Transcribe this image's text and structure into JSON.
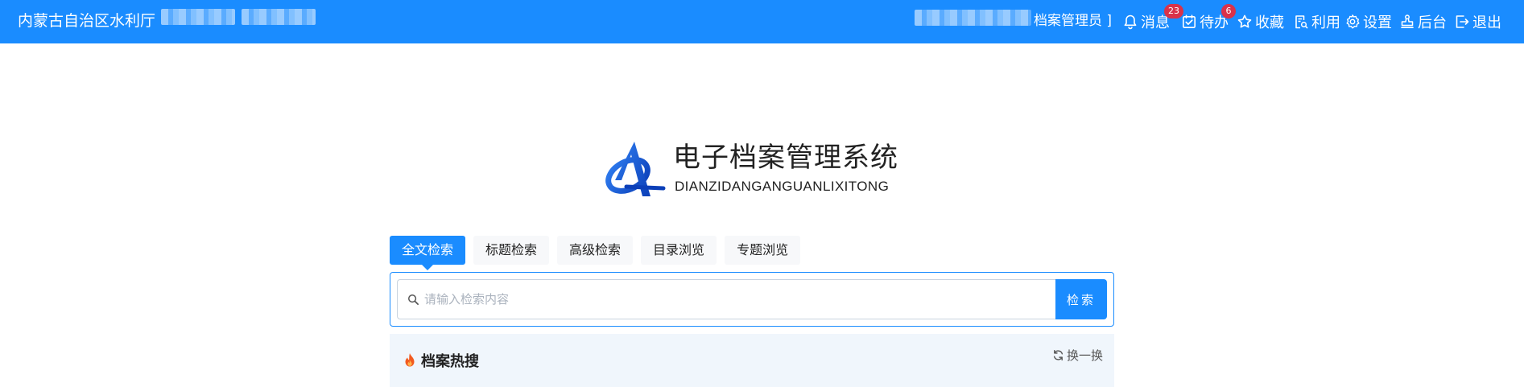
{
  "header": {
    "org_name": "内蒙古自治区水利厅",
    "user_role": "档案管理员 ]",
    "nav": [
      {
        "label": "消息",
        "icon": "bell-icon",
        "badge": "23"
      },
      {
        "label": "待办",
        "icon": "checklist-icon",
        "badge": "6"
      },
      {
        "label": "收藏",
        "icon": "star-icon"
      },
      {
        "label": "利用",
        "icon": "document-search-icon"
      },
      {
        "label": "设置",
        "icon": "gear-icon"
      },
      {
        "label": "后台",
        "icon": "stamp-icon"
      },
      {
        "label": "退出",
        "icon": "logout-icon"
      }
    ]
  },
  "logo": {
    "title": "电子档案管理系统",
    "subtitle": "DIANZIDANGANGUANLIXITONG"
  },
  "tabs": [
    {
      "label": "全文检索",
      "active": true
    },
    {
      "label": "标题检索"
    },
    {
      "label": "高级检索"
    },
    {
      "label": "目录浏览"
    },
    {
      "label": "专题浏览"
    }
  ],
  "search": {
    "placeholder": "请输入检索内容",
    "value": "",
    "button_label": "检索"
  },
  "hot_search": {
    "title": "档案热搜",
    "refresh_label": "换一换"
  },
  "colors": {
    "primary": "#1a8cff",
    "badge": "#d9324a",
    "hot_panel_bg": "#f0f6fc",
    "flame": "#f25a1f"
  }
}
